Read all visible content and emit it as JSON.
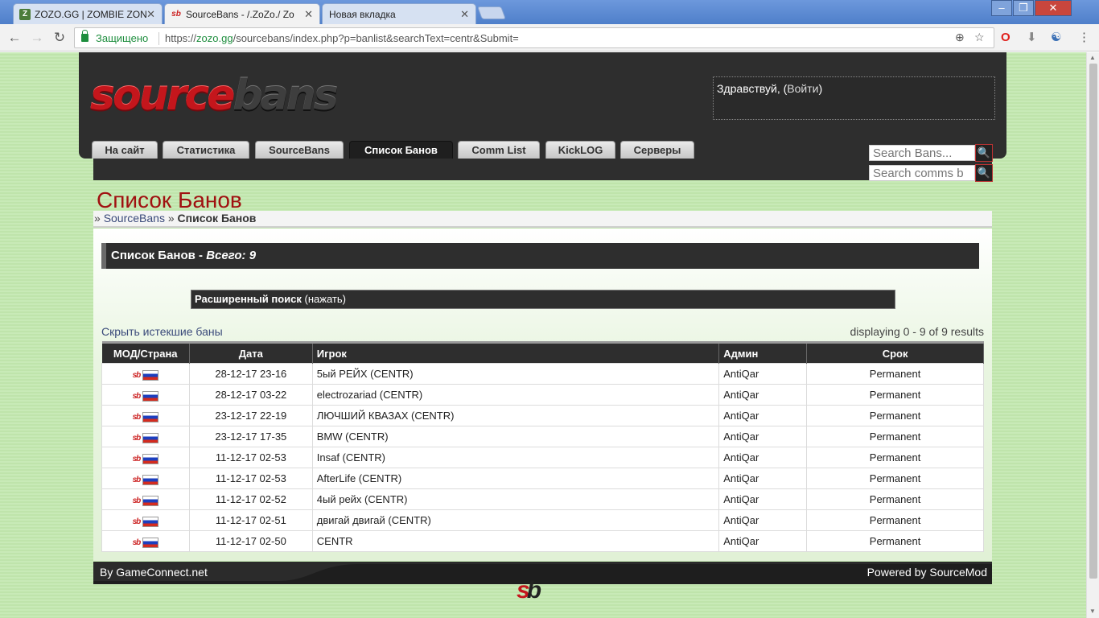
{
  "browser": {
    "tabs": [
      {
        "title": "ZOZO.GG | ZOMBIE ZON",
        "favicon": "Z"
      },
      {
        "title": "SourceBans - /.ZoZo./ Zo",
        "favicon": "sb"
      },
      {
        "title": "Новая вкладка",
        "favicon": ""
      }
    ],
    "secure_label": "Защищено",
    "url_scheme": "https://",
    "url_host": "zozo.gg",
    "url_path": "/sourcebans/index.php?p=banlist&searchText=centr&Submit="
  },
  "header": {
    "logo_part1": "source",
    "logo_part2": "bans",
    "greeting": "Здравствуй, (",
    "login_link": "Войти",
    "greeting_end": ")"
  },
  "nav": {
    "tabs": [
      "На сайт",
      "Статистика",
      "SourceBans",
      "Список Банов",
      "Comm List",
      "KickLOG",
      "Серверы"
    ],
    "active": "Список Банов"
  },
  "search": {
    "bans_placeholder": "Search Bans...",
    "comms_placeholder": "Search comms b"
  },
  "page": {
    "title": "Список Банов",
    "breadcrumb_sep": "»",
    "breadcrumb_link": "SourceBans",
    "breadcrumb_current": "Список Банов"
  },
  "banlist": {
    "box_title": "Список Банов",
    "box_total_prefix": "Всего: 9",
    "adv_search_label": "Расширенный поиск",
    "adv_search_link": "(нажать)",
    "hide_expired": "Скрыть истекшие баны",
    "displaying": "displaying 0 - 9 of 9 results",
    "columns": [
      "МОД/Страна",
      "Дата",
      "Игрок",
      "Админ",
      "Срок"
    ],
    "rows": [
      {
        "date": "28-12-17 23-16",
        "player": "5ый РЕЙХ (CENTR)",
        "admin": "AntiQar",
        "length": "Permanent"
      },
      {
        "date": "28-12-17 03-22",
        "player": "electrozariad (CENTR)",
        "admin": "AntiQar",
        "length": "Permanent"
      },
      {
        "date": "23-12-17 22-19",
        "player": "ЛЮЧШИЙ КВАЗАХ (CENTR)",
        "admin": "AntiQar",
        "length": "Permanent"
      },
      {
        "date": "23-12-17 17-35",
        "player": "BMW (CENTR)",
        "admin": "AntiQar",
        "length": "Permanent"
      },
      {
        "date": "11-12-17 02-53",
        "player": "Insaf (CENTR)",
        "admin": "AntiQar",
        "length": "Permanent"
      },
      {
        "date": "11-12-17 02-53",
        "player": "AfterLife (CENTR)",
        "admin": "AntiQar",
        "length": "Permanent"
      },
      {
        "date": "11-12-17 02-52",
        "player": "4ый рейх (CENTR)",
        "admin": "AntiQar",
        "length": "Permanent"
      },
      {
        "date": "11-12-17 02-51",
        "player": "двигай двигай (CENTR)",
        "admin": "AntiQar",
        "length": "Permanent"
      },
      {
        "date": "11-12-17 02-50",
        "player": "CENTR",
        "admin": "AntiQar",
        "length": "Permanent"
      }
    ]
  },
  "footer": {
    "left": "By GameConnect.net",
    "right": "Powered by SourceMod",
    "logo_a": "s",
    "logo_b": "b"
  },
  "colors": {
    "page_bg": "#c8eab7",
    "dark": "#2e2e2e",
    "accent_red": "#c4161c",
    "title_red": "#a01010",
    "link": "#3a4a7a"
  }
}
